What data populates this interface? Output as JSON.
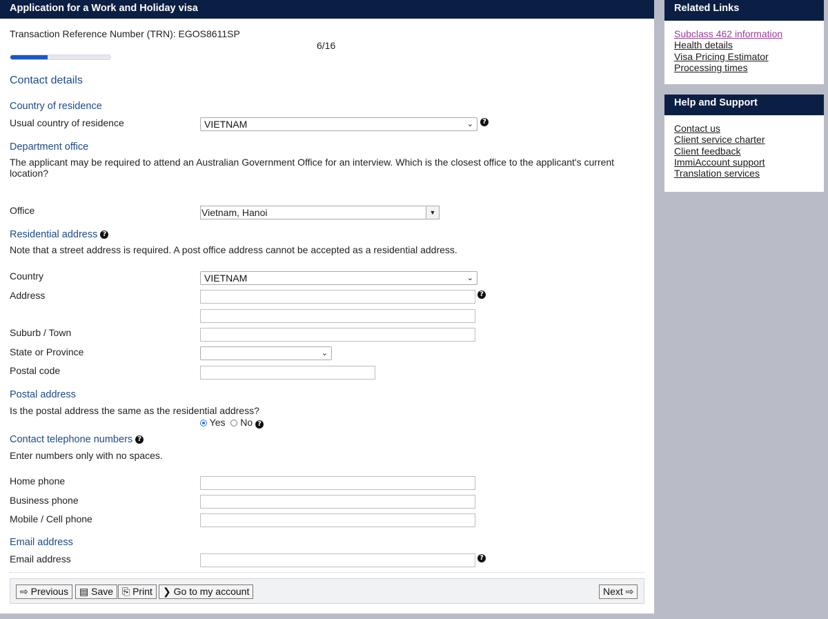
{
  "header": {
    "title": "Application for a Work and Holiday visa"
  },
  "trn": {
    "label": "Transaction Reference Number (TRN): EGOS8611SP"
  },
  "progress": {
    "step": "6/16",
    "fraction": 0.375
  },
  "sections": {
    "contact_details": "Contact details",
    "country_of_residence": "Country of residence",
    "department_office": "Department office",
    "residential_address": "Residential address",
    "postal_address": "Postal address",
    "contact_phone": "Contact telephone numbers",
    "email_address": "Email address"
  },
  "fields": {
    "usual_country": {
      "label": "Usual country of residence",
      "value": "VIETNAM"
    },
    "office_note": "The applicant may be required to attend an Australian Government Office for an interview. Which is the closest office to the applicant's current location?",
    "office": {
      "label": "Office",
      "value": "Vietnam, Hanoi"
    },
    "residential_note": "Note that a street address is required. A post office address cannot be accepted as a residential address.",
    "country": {
      "label": "Country",
      "value": "VIETNAM"
    },
    "address": {
      "label": "Address",
      "value": ""
    },
    "suburb": {
      "label": "Suburb / Town",
      "value": ""
    },
    "state": {
      "label": "State or Province",
      "value": ""
    },
    "postal_code": {
      "label": "Postal code",
      "value": ""
    },
    "postal_same_question": "Is the postal address the same as the residential address?",
    "postal_same_options": {
      "yes": "Yes",
      "no": "No",
      "selected": "Yes"
    },
    "phone_note": "Enter numbers only with no spaces.",
    "home_phone": {
      "label": "Home phone",
      "value": ""
    },
    "business_phone": {
      "label": "Business phone",
      "value": ""
    },
    "mobile_phone": {
      "label": "Mobile / Cell phone",
      "value": ""
    },
    "email": {
      "label": "Email address",
      "value": ""
    }
  },
  "buttons": {
    "previous": "Previous",
    "save": "Save",
    "print": "Print",
    "go_to_account": "Go to my account",
    "next": "Next"
  },
  "sidebar": {
    "related_links": {
      "title": "Related Links",
      "links": [
        "Subclass 462 information",
        "Health details",
        "Visa Pricing Estimator",
        "Processing times"
      ]
    },
    "help_support": {
      "title": "Help and Support",
      "links": [
        "Contact us",
        "Client service charter",
        "Client feedback",
        "ImmiAccount support",
        "Translation services"
      ]
    }
  },
  "colors": {
    "header_bg": "#0b1e43",
    "section_title": "#1c4a8c",
    "progress_fill": "#1e57c4",
    "page_bg": "#b9bcc6",
    "visited_link": "#9b3d9b"
  }
}
